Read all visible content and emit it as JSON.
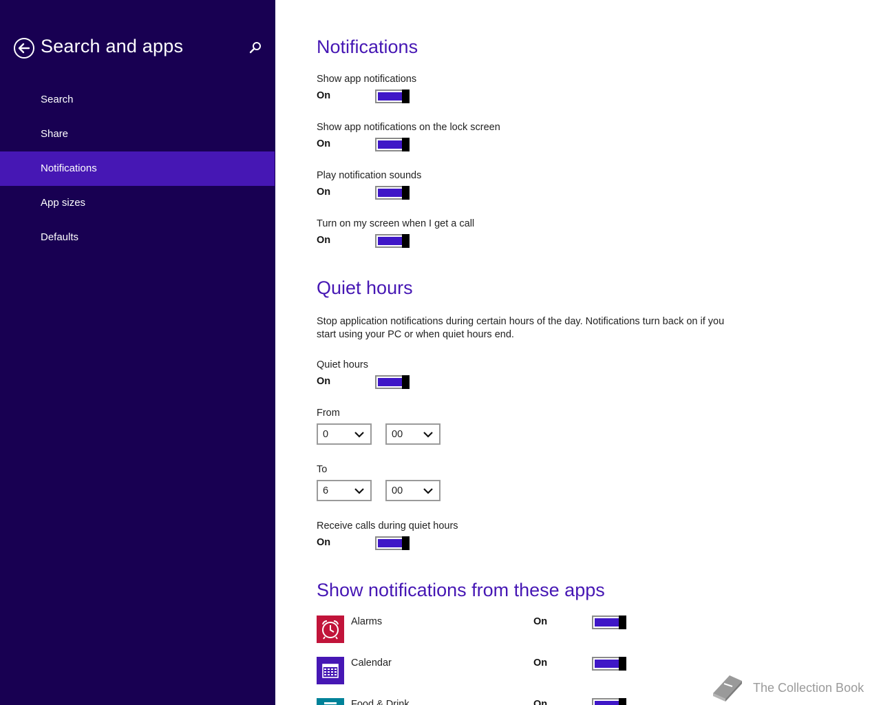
{
  "left_pane": {
    "title": "Search and apps",
    "nav_items": [
      {
        "label": "Search",
        "selected": false
      },
      {
        "label": "Share",
        "selected": false
      },
      {
        "label": "Notifications",
        "selected": true
      },
      {
        "label": "App sizes",
        "selected": false
      },
      {
        "label": "Defaults",
        "selected": false
      }
    ]
  },
  "notifications": {
    "heading": "Notifications",
    "settings": [
      {
        "label": "Show app notifications",
        "state": "On"
      },
      {
        "label": "Show app notifications on the lock screen",
        "state": "On"
      },
      {
        "label": "Play notification sounds",
        "state": "On"
      },
      {
        "label": "Turn on my screen when I get a call",
        "state": "On"
      }
    ]
  },
  "quiet_hours": {
    "heading": "Quiet hours",
    "description": "Stop application notifications during certain hours of the day. Notifications turn back on if you start using your PC or when quiet hours end.",
    "toggle_label": "Quiet hours",
    "toggle_state": "On",
    "from_label": "From",
    "from_hour": "0",
    "from_minute": "00",
    "to_label": "To",
    "to_hour": "6",
    "to_minute": "00",
    "receive_calls_label": "Receive calls during quiet hours",
    "receive_calls_state": "On"
  },
  "apps_section": {
    "heading": "Show notifications from these apps",
    "apps": [
      {
        "name": "Alarms",
        "state": "On",
        "icon": "alarm-clock-icon",
        "tile_color": "#c1143a"
      },
      {
        "name": "Calendar",
        "state": "On",
        "icon": "calendar-icon",
        "tile_color": "#4617b4"
      },
      {
        "name": "Food & Drink",
        "state": "On",
        "icon": "food-drink-icon",
        "tile_color": "#008299"
      }
    ]
  },
  "watermark": {
    "text": "The Collection Book"
  },
  "colors": {
    "left_pane_bg": "#180052",
    "selected_nav_bg": "#4617b4",
    "accent": "#4617b4",
    "toggle_fill": "#3f17c7"
  }
}
